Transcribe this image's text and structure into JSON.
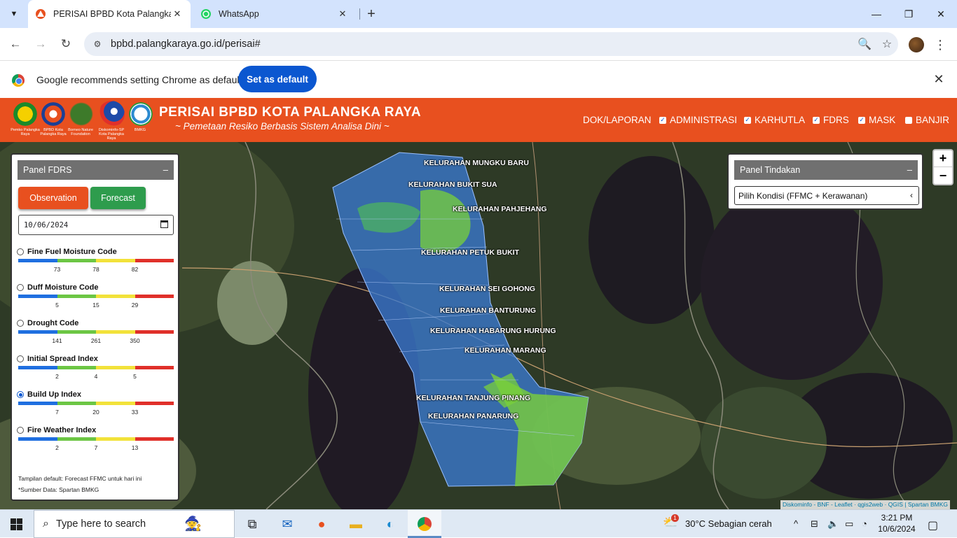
{
  "browser": {
    "tabs": [
      {
        "title": "PERISAI BPBD Kota Palangka Raya",
        "active": true,
        "icon": "bpbd-favicon-icon"
      },
      {
        "title": "WhatsApp",
        "active": false,
        "icon": "whatsapp-icon"
      }
    ],
    "url": "bpbd.palangkaraya.go.id/perisai#"
  },
  "infobar": {
    "message": "Google recommends setting Chrome as default",
    "button": "Set as default"
  },
  "site": {
    "title": "PERISAI BPBD KOTA PALANGKA RAYA",
    "subtitle": "~ Pemetaan Resiko Berbasis Sistem Analisa Dini ~",
    "logos": [
      {
        "caption": "Pemko Palangka Raya"
      },
      {
        "caption": "BPBD Kota Palangka Raya"
      },
      {
        "caption": "Borneo Nature Foundation"
      },
      {
        "caption": "Diskominfo-SP Kota Palangka Raya"
      },
      {
        "caption": "BMKG"
      }
    ],
    "menu": [
      {
        "label": "DOK/LAPORAN",
        "checkbox": false
      },
      {
        "label": "ADMINISTRASI",
        "checkbox": true,
        "checked": true
      },
      {
        "label": "KARHUTLA",
        "checkbox": true,
        "checked": true
      },
      {
        "label": "FDRS",
        "checkbox": true,
        "checked": true
      },
      {
        "label": "MASK",
        "checkbox": true,
        "checked": true
      },
      {
        "label": "BANJIR",
        "checkbox": true,
        "checked": false
      }
    ]
  },
  "panel_fdrs": {
    "title": "Panel FDRS",
    "minimize": "–",
    "observation": "Observation",
    "forecast": "Forecast",
    "date": "10/06/2024",
    "indices": [
      {
        "name": "Fine Fuel Moisture Code",
        "ticks": [
          "73",
          "78",
          "82"
        ],
        "selected": false
      },
      {
        "name": "Duff Moisture Code",
        "ticks": [
          "5",
          "15",
          "29"
        ],
        "selected": false
      },
      {
        "name": "Drought Code",
        "ticks": [
          "141",
          "261",
          "350"
        ],
        "selected": false
      },
      {
        "name": "Initial Spread Index",
        "ticks": [
          "2",
          "4",
          "5"
        ],
        "selected": false
      },
      {
        "name": "Build Up Index",
        "ticks": [
          "7",
          "20",
          "33"
        ],
        "selected": true
      },
      {
        "name": "Fire Weather Index",
        "ticks": [
          "2",
          "7",
          "13"
        ],
        "selected": false
      }
    ],
    "scale_colors": [
      "#1f6fe0",
      "#6cc644",
      "#f2e23a",
      "#e0302a"
    ],
    "note1": "Tampilan default: Forecast FFMC untuk hari ini",
    "note2": "*Sumber Data: Spartan BMKG"
  },
  "panel_tindakan": {
    "title": "Panel Tindakan",
    "minimize": "–",
    "select_value": "Pilih Kondisi (FFMC + Kerawanan)"
  },
  "map": {
    "labels": [
      "KELURAHAN MUNGKU BARU",
      "KELURAHAN BUKIT SUA",
      "KELURAHAN PAHJEHANG",
      "KELURAHAN PETUK BUKIT",
      "KELURAHAN SEI GOHONG",
      "KELURAHAN BANTURUNG",
      "KELURAHAN HABARUNG HURUNG",
      "KELURAHAN MARANG",
      "KELURAHAN TANJUNG PINANG",
      "KELURAHAN PANARUNG"
    ],
    "zoom_in": "+",
    "zoom_out": "−",
    "attribution": "Diskominfo - BNF - Leaflet · qgis2web · QGIS | Spartan BMKG"
  },
  "taskbar": {
    "search_placeholder": "Type here to search",
    "weather": "30°C  Sebagian cerah",
    "weather_badge": "1",
    "time": "3:21 PM",
    "date": "10/6/2024"
  }
}
